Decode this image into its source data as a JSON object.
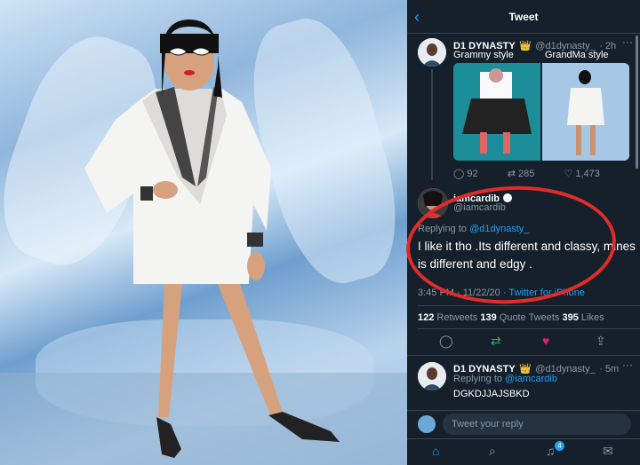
{
  "header": {
    "title": "Tweet"
  },
  "tweet1": {
    "name": "D1 DYNASTY",
    "badge": "👑",
    "handle": "@d1dynasty_",
    "time": "· 2h",
    "caption_left": "Grammy style",
    "caption_right": "GrandMa style",
    "replies": "92",
    "retweets": "285",
    "likes": "1,473"
  },
  "tweet2": {
    "name": "iamcardib",
    "handle": "@iamcardib",
    "replying_prefix": "Replying to ",
    "replying_to": "@d1dynasty_",
    "text": "I like it tho .Its different and classy, mines is different and edgy .",
    "time": "3:45 PM · 11/22/20",
    "source": "· Twitter for iPhone"
  },
  "stats": {
    "retweets_count": "122",
    "retweets_label": "Retweets",
    "quotes_count": "139",
    "quotes_label": "Quote Tweets",
    "likes_count": "395",
    "likes_label": "Likes"
  },
  "reply": {
    "name": "D1 DYNASTY",
    "badge": "👑",
    "handle": "@d1dynasty_",
    "time": "· 5m",
    "replying_prefix": "Replying to ",
    "replying_to": "@iamcardib",
    "text": "DGKDJJAJSBKD"
  },
  "composer": {
    "placeholder": "Tweet your reply"
  },
  "tabbar": {
    "notifications_badge": "4"
  },
  "colors": {
    "accent": "#1da1f2",
    "background": "#15202b",
    "like": "#e0245e",
    "retweet": "#17bf63",
    "highlight": "#e22b2b"
  }
}
